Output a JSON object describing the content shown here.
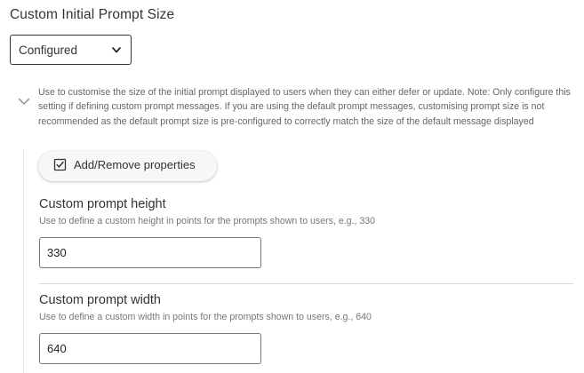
{
  "section": {
    "title": "Custom Initial Prompt Size"
  },
  "dropdown": {
    "selected": "Configured",
    "icon": "chevron-down-icon"
  },
  "description": {
    "text": "Use to customise the size of the initial prompt displayed to users when they can either defer or update. Note: Only configure this setting if defining custom prompt messages. If you are using the default prompt messages, customising prompt size is not recommended as the default prompt size is pre-configured to correctly match the size of the default message displayed",
    "toggle_icon": "chevron-down-icon"
  },
  "properties_button": {
    "label": "Add/Remove properties",
    "icon": "checkbox-icon"
  },
  "fields": [
    {
      "title": "Custom prompt height",
      "help": "Use to define a custom height in points for the prompts shown to users, e.g., 330",
      "value": "330"
    },
    {
      "title": "Custom prompt width",
      "help": "Use to define a custom width in points for the prompts shown to users, e.g., 640",
      "value": "640"
    }
  ]
}
